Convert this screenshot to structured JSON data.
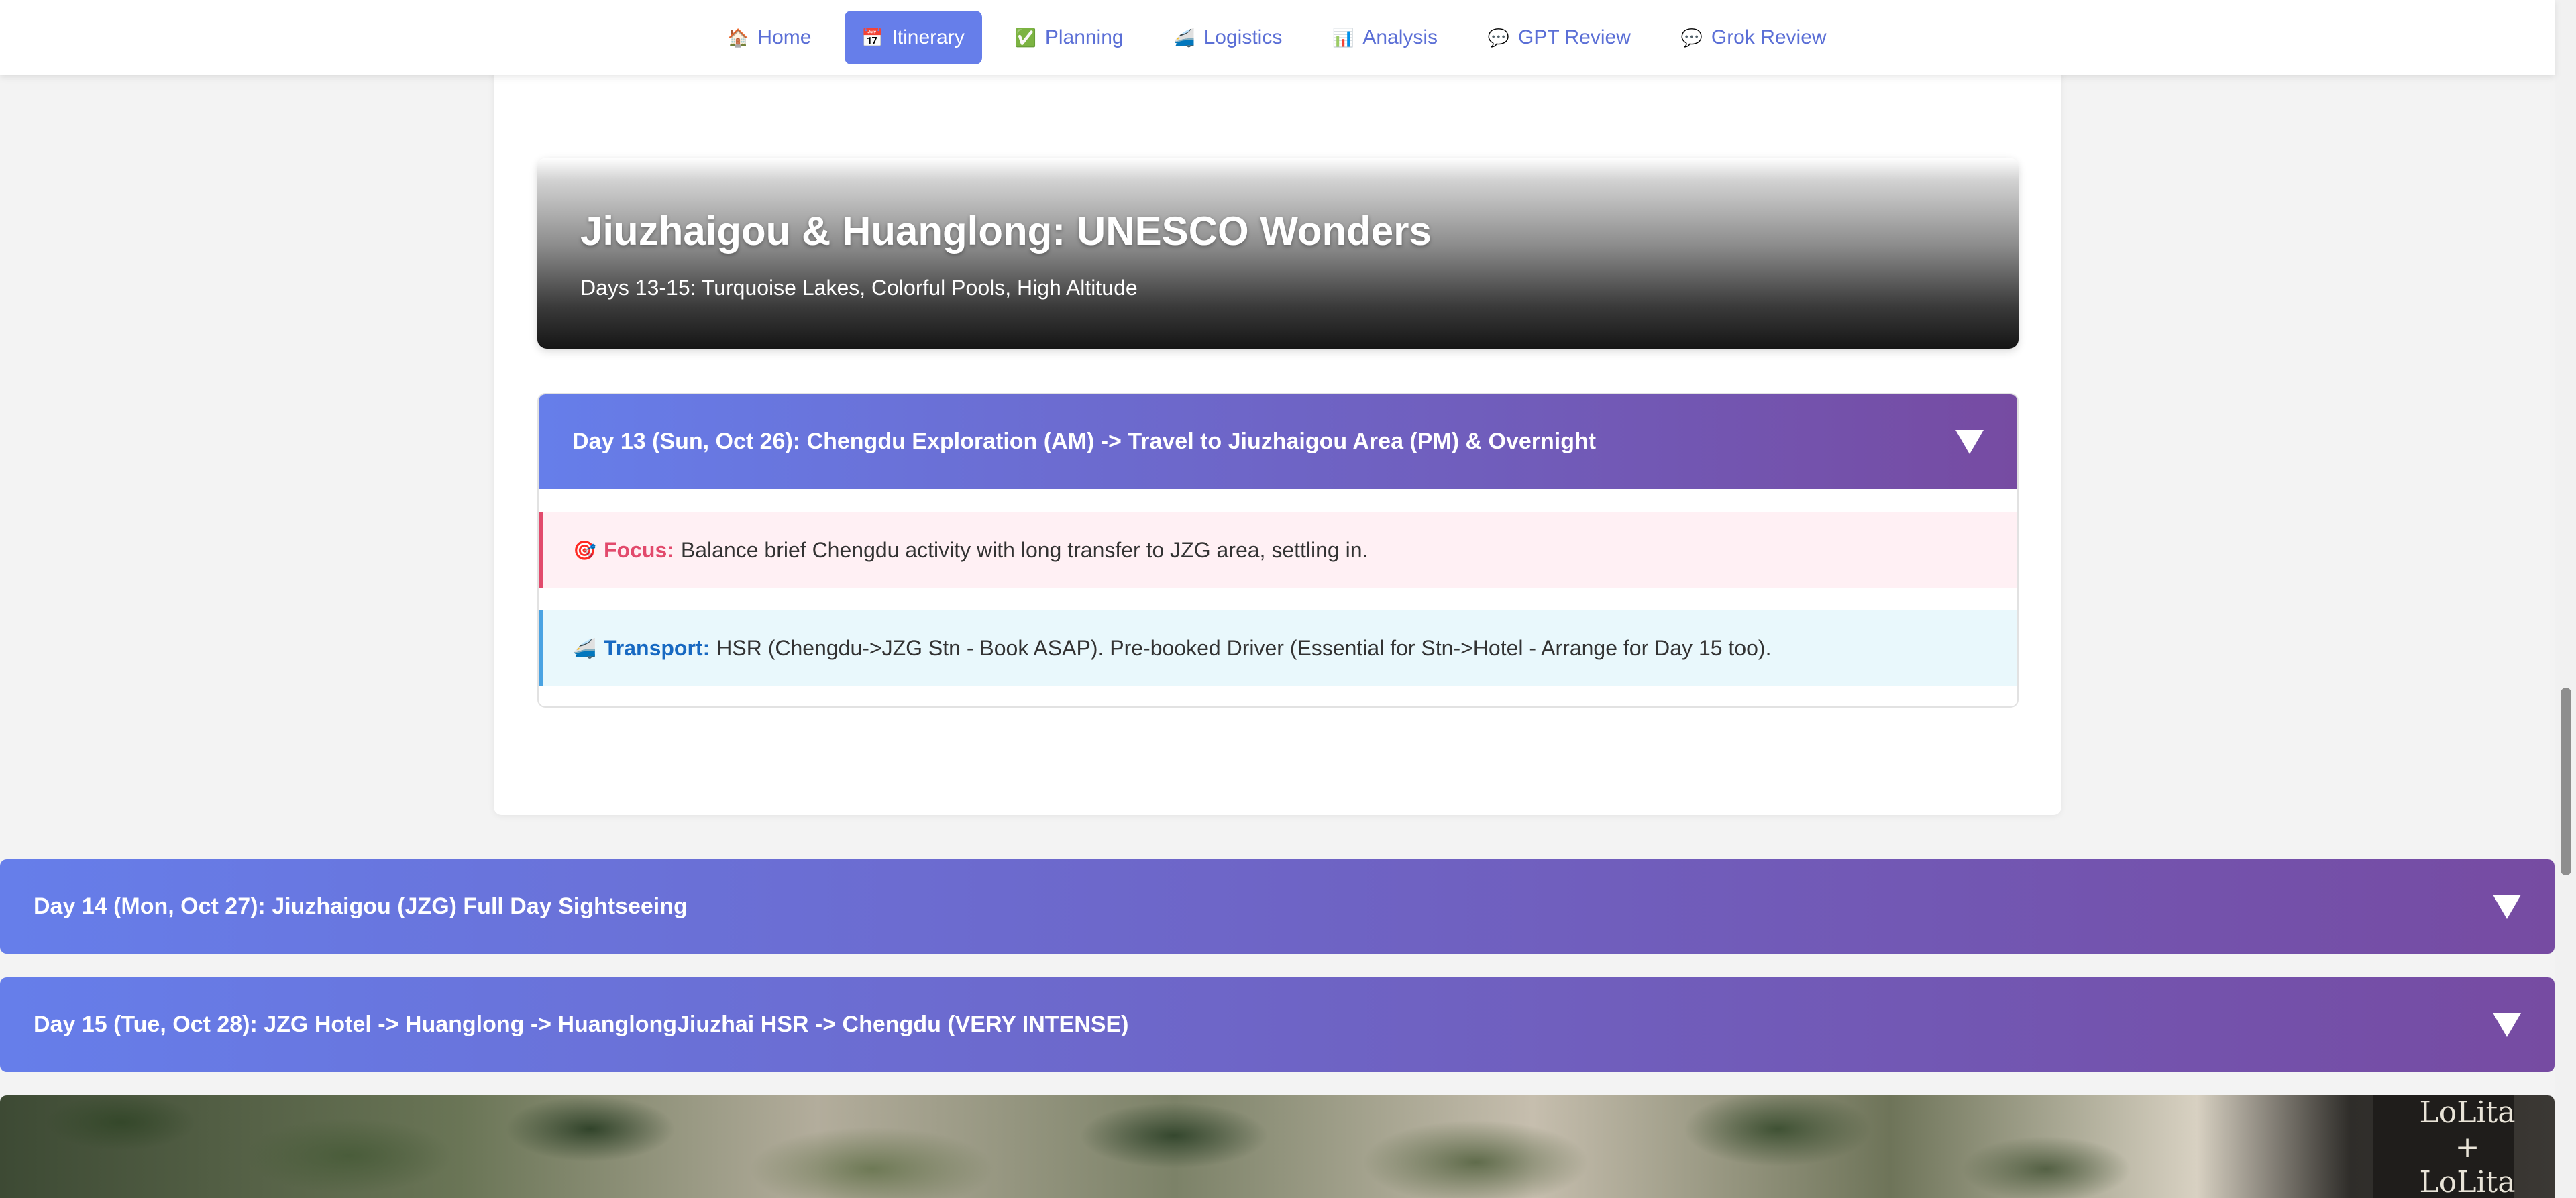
{
  "nav": {
    "items": [
      {
        "label": "Home",
        "icon": "🏠",
        "active": false
      },
      {
        "label": "Itinerary",
        "icon": "📅",
        "active": true
      },
      {
        "label": "Planning",
        "icon": "✅",
        "active": false
      },
      {
        "label": "Logistics",
        "icon": "🚄",
        "active": false
      },
      {
        "label": "Analysis",
        "icon": "📊",
        "active": false
      },
      {
        "label": "GPT Review",
        "icon": "💬",
        "active": false
      },
      {
        "label": "Grok Review",
        "icon": "💬",
        "active": false
      }
    ]
  },
  "hero": {
    "title": "Jiuzhaigou & Huanglong: UNESCO Wonders",
    "subtitle": "Days 13-15: Turquoise Lakes, Colorful Pools, High Altitude"
  },
  "days": [
    {
      "title": "Day 13 (Sun, Oct 26): Chengdu Exploration (AM) -> Travel to Jiuzhaigou Area (PM) & Overnight",
      "expanded": true,
      "focus": {
        "icon": "🎯",
        "label": "Focus:",
        "text": "Balance brief Chengdu activity with long transfer to JZG area, settling in."
      },
      "transport": {
        "icon": "🚄",
        "label": "Transport:",
        "text": "HSR (Chengdu->JZG Stn - Book ASAP). Pre-booked Driver (Essential for Stn->Hotel - Arrange for Day 15 too)."
      }
    },
    {
      "title": "Day 14 (Mon, Oct 27): Jiuzhaigou (JZG) Full Day Sightseeing",
      "expanded": false
    },
    {
      "title": "Day 15 (Tue, Oct 28): JZG Hotel -> Huanglong -> HuanglongJiuzhai HSR -> Chengdu (VERY INTENSE)",
      "expanded": false
    }
  ],
  "photo": {
    "sign_text": "LoLita\n+\nLoLita"
  },
  "colors": {
    "accent": "#667eea",
    "accent_end": "#764ba2",
    "focus": "#e24a6c",
    "transport": "#1769c2"
  }
}
